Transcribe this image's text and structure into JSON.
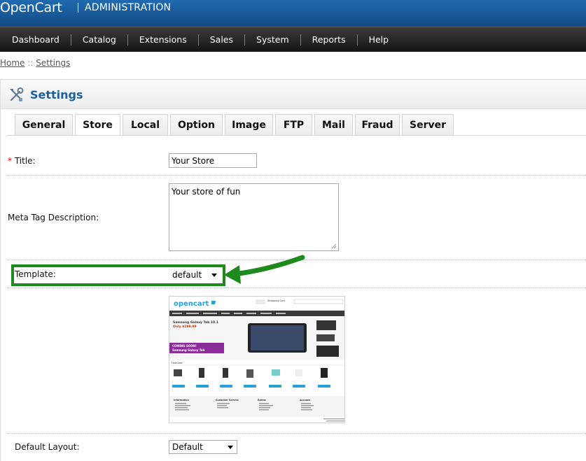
{
  "header": {
    "logo": "OpenCart",
    "subtitle": "ADMINISTRATION"
  },
  "menu": {
    "items": [
      "Dashboard",
      "Catalog",
      "Extensions",
      "Sales",
      "System",
      "Reports",
      "Help"
    ]
  },
  "breadcrumb": {
    "home": "Home",
    "separator": "::",
    "current": "Settings"
  },
  "page": {
    "title": "Settings"
  },
  "tabs": [
    {
      "label": "General"
    },
    {
      "label": "Store"
    },
    {
      "label": "Local"
    },
    {
      "label": "Option"
    },
    {
      "label": "Image"
    },
    {
      "label": "FTP"
    },
    {
      "label": "Mail"
    },
    {
      "label": "Fraud"
    },
    {
      "label": "Server"
    }
  ],
  "active_tab": "Store",
  "form": {
    "title_label": "Title:",
    "title_required": "*",
    "title_value": "Your Store",
    "meta_label": "Meta Tag Description:",
    "meta_value": "Your store of fun",
    "template_label": "Template:",
    "template_value": "default",
    "layout_label": "Default Layout:",
    "layout_value": "Default"
  },
  "preview": {
    "logo": "opencart",
    "cart_title": "Shopping Cart",
    "banner_title": "Samsung Galaxy Tab 10.1",
    "banner_price": "Only $199.99",
    "banner_ribbon_1": "COMING SOON!",
    "banner_ribbon_2": "Samsung Galaxy Tab",
    "featured_label": "Featured",
    "footer_headings": [
      "Information",
      "Customer Service",
      "Extras",
      "Account"
    ]
  },
  "colors": {
    "header_blue": "#1a5d9f",
    "menu_dark": "#222222",
    "title_blue": "#1b5fa0",
    "highlight_green": "#1e8a1e",
    "required_red": "#ee0000"
  }
}
